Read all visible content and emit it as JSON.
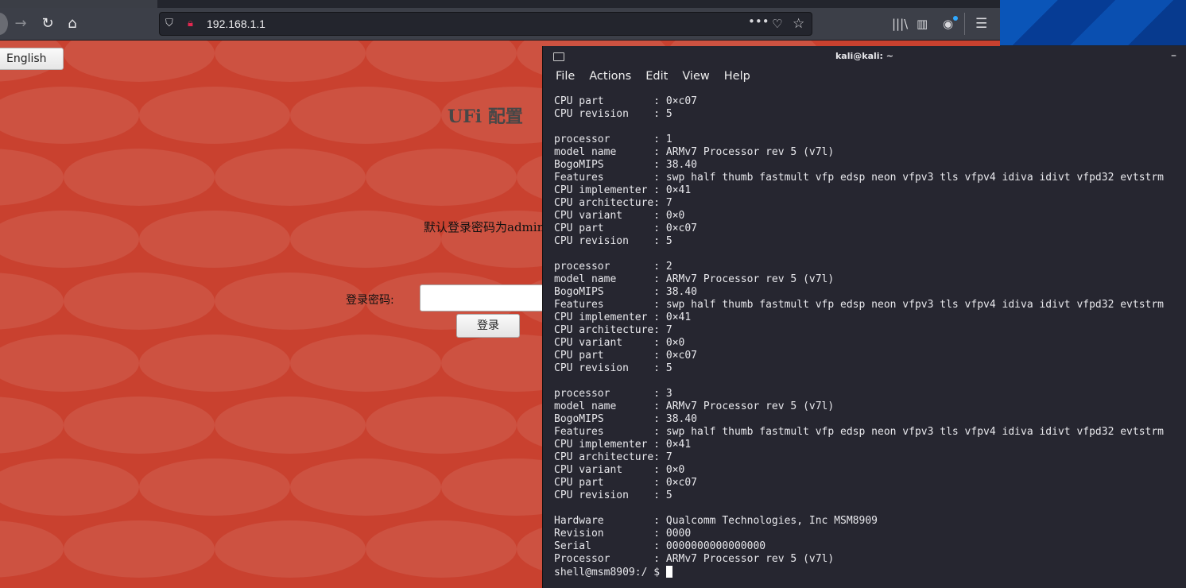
{
  "browser": {
    "url": "192.168.1.1",
    "icons": [
      "back-icon",
      "forward-icon",
      "reload-icon",
      "home-icon",
      "shield-icon",
      "insecure-lock-icon",
      "more-icon",
      "pocket-icon",
      "star-icon",
      "library-icon",
      "sidebar-icon",
      "account-icon",
      "menu-icon"
    ]
  },
  "page": {
    "language_button": "English",
    "title": "UFi 配置",
    "hint": "默认登录密码为admin",
    "password_label": "登录密码:",
    "password_value": "",
    "login_button": "登录",
    "background_color": "#c9412f"
  },
  "terminal": {
    "title": "kali@kali: ~",
    "menu": [
      "File",
      "Actions",
      "Edit",
      "View",
      "Help"
    ],
    "lines": [
      "CPU part        : 0×c07",
      "CPU revision    : 5",
      "",
      "processor       : 1",
      "model name      : ARMv7 Processor rev 5 (v7l)",
      "BogoMIPS        : 38.40",
      "Features        : swp half thumb fastmult vfp edsp neon vfpv3 tls vfpv4 idiva idivt vfpd32 evtstrm",
      "CPU implementer : 0×41",
      "CPU architecture: 7",
      "CPU variant     : 0×0",
      "CPU part        : 0×c07",
      "CPU revision    : 5",
      "",
      "processor       : 2",
      "model name      : ARMv7 Processor rev 5 (v7l)",
      "BogoMIPS        : 38.40",
      "Features        : swp half thumb fastmult vfp edsp neon vfpv3 tls vfpv4 idiva idivt vfpd32 evtstrm",
      "CPU implementer : 0×41",
      "CPU architecture: 7",
      "CPU variant     : 0×0",
      "CPU part        : 0×c07",
      "CPU revision    : 5",
      "",
      "processor       : 3",
      "model name      : ARMv7 Processor rev 5 (v7l)",
      "BogoMIPS        : 38.40",
      "Features        : swp half thumb fastmult vfp edsp neon vfpv3 tls vfpv4 idiva idivt vfpd32 evtstrm",
      "CPU implementer : 0×41",
      "CPU architecture: 7",
      "CPU variant     : 0×0",
      "CPU part        : 0×c07",
      "CPU revision    : 5",
      "",
      "Hardware        : Qualcomm Technologies, Inc MSM8909",
      "Revision        : 0000",
      "Serial          : 0000000000000000",
      "Processor       : ARMv7 Processor rev 5 (v7l)"
    ],
    "prompt": "shell@msm8909:/ $ "
  }
}
